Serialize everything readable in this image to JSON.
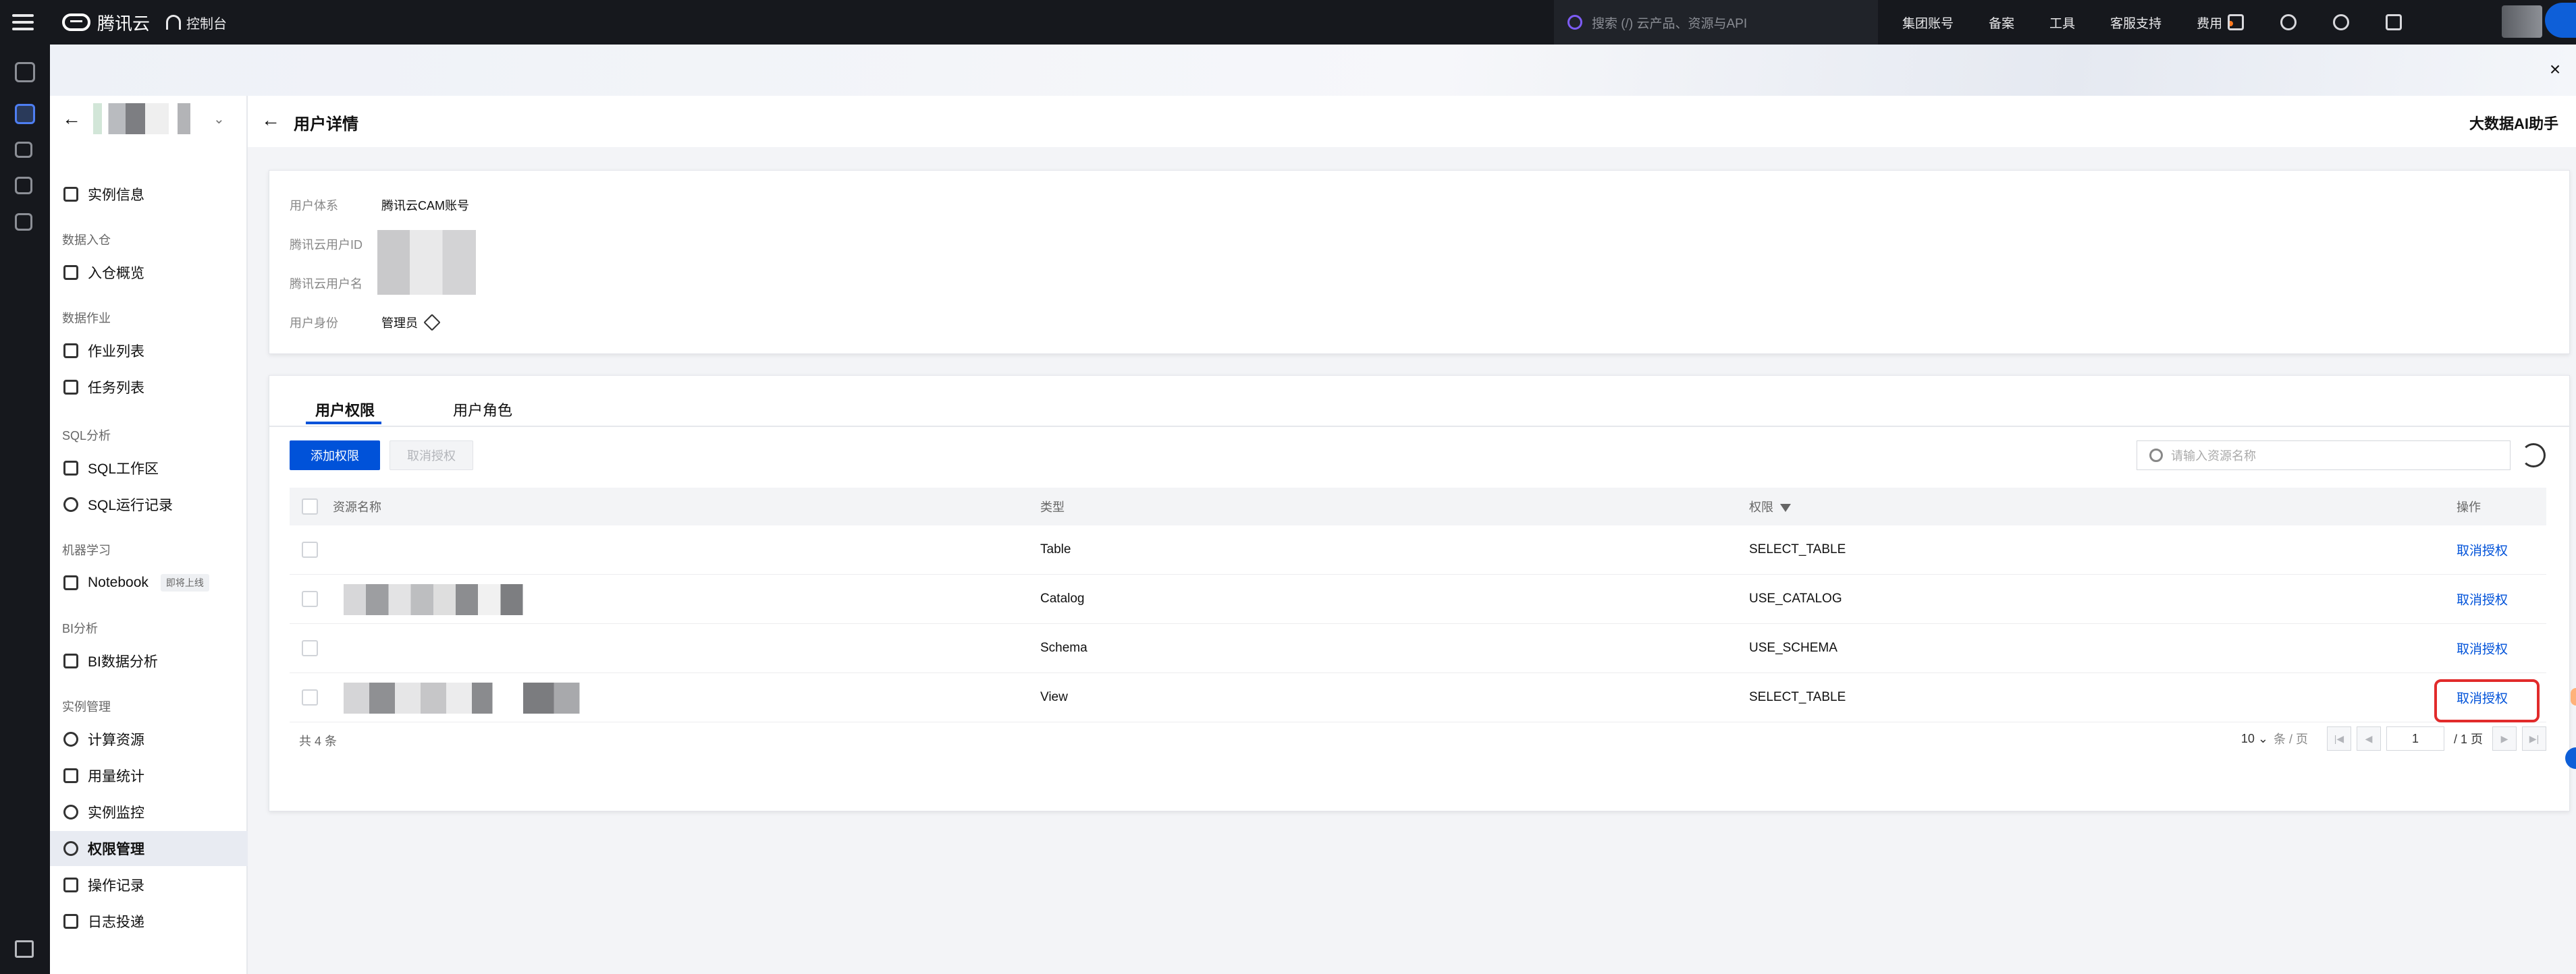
{
  "topbar": {
    "brand": "腾讯云",
    "console": "控制台",
    "search_placeholder": "搜索 (/) 云产品、资源与API",
    "nav": [
      "集团账号",
      "备案",
      "工具",
      "客服支持",
      "费用"
    ]
  },
  "sidebar": {
    "sections": {
      "data_ingest": "数据入仓",
      "data_job": "数据作业",
      "sql": "SQL分析",
      "ml": "机器学习",
      "bi": "BI分析",
      "instance": "实例管理"
    },
    "items": {
      "instance_info": "实例信息",
      "ingest_overview": "入仓概览",
      "job_list": "作业列表",
      "task_list": "任务列表",
      "sql_workspace": "SQL工作区",
      "sql_history": "SQL运行记录",
      "notebook": "Notebook",
      "notebook_tag": "即将上线",
      "bi_analysis": "BI数据分析",
      "compute": "计算资源",
      "usage": "用量统计",
      "monitor": "实例监控",
      "permission": "权限管理",
      "operation_log": "操作记录",
      "log_delivery": "日志投递"
    }
  },
  "page": {
    "title": "用户详情",
    "ai_assistant": "大数据AI助手"
  },
  "user_info": {
    "system_label": "用户体系",
    "system_value": "腾讯云CAM账号",
    "id_label": "腾讯云用户ID",
    "name_label": "腾讯云用户名",
    "role_label": "用户身份",
    "role_value": "管理员"
  },
  "tabs": {
    "permissions": "用户权限",
    "roles": "用户角色"
  },
  "toolbar": {
    "add": "添加权限",
    "revoke": "取消授权",
    "search_placeholder": "请输入资源名称"
  },
  "table": {
    "headers": {
      "resource": "资源名称",
      "type": "类型",
      "permission": "权限",
      "action": "操作"
    },
    "rows": [
      {
        "type": "Table",
        "permission": "SELECT_TABLE",
        "action": "取消授权"
      },
      {
        "type": "Catalog",
        "permission": "USE_CATALOG",
        "action": "取消授权"
      },
      {
        "type": "Schema",
        "permission": "USE_SCHEMA",
        "action": "取消授权"
      },
      {
        "type": "View",
        "permission": "SELECT_TABLE",
        "action": "取消授权"
      }
    ],
    "total": "共 4 条",
    "page_size": "10",
    "page_size_unit": "条 / 页",
    "page_value": "1",
    "page_total": "/ 1 页"
  }
}
